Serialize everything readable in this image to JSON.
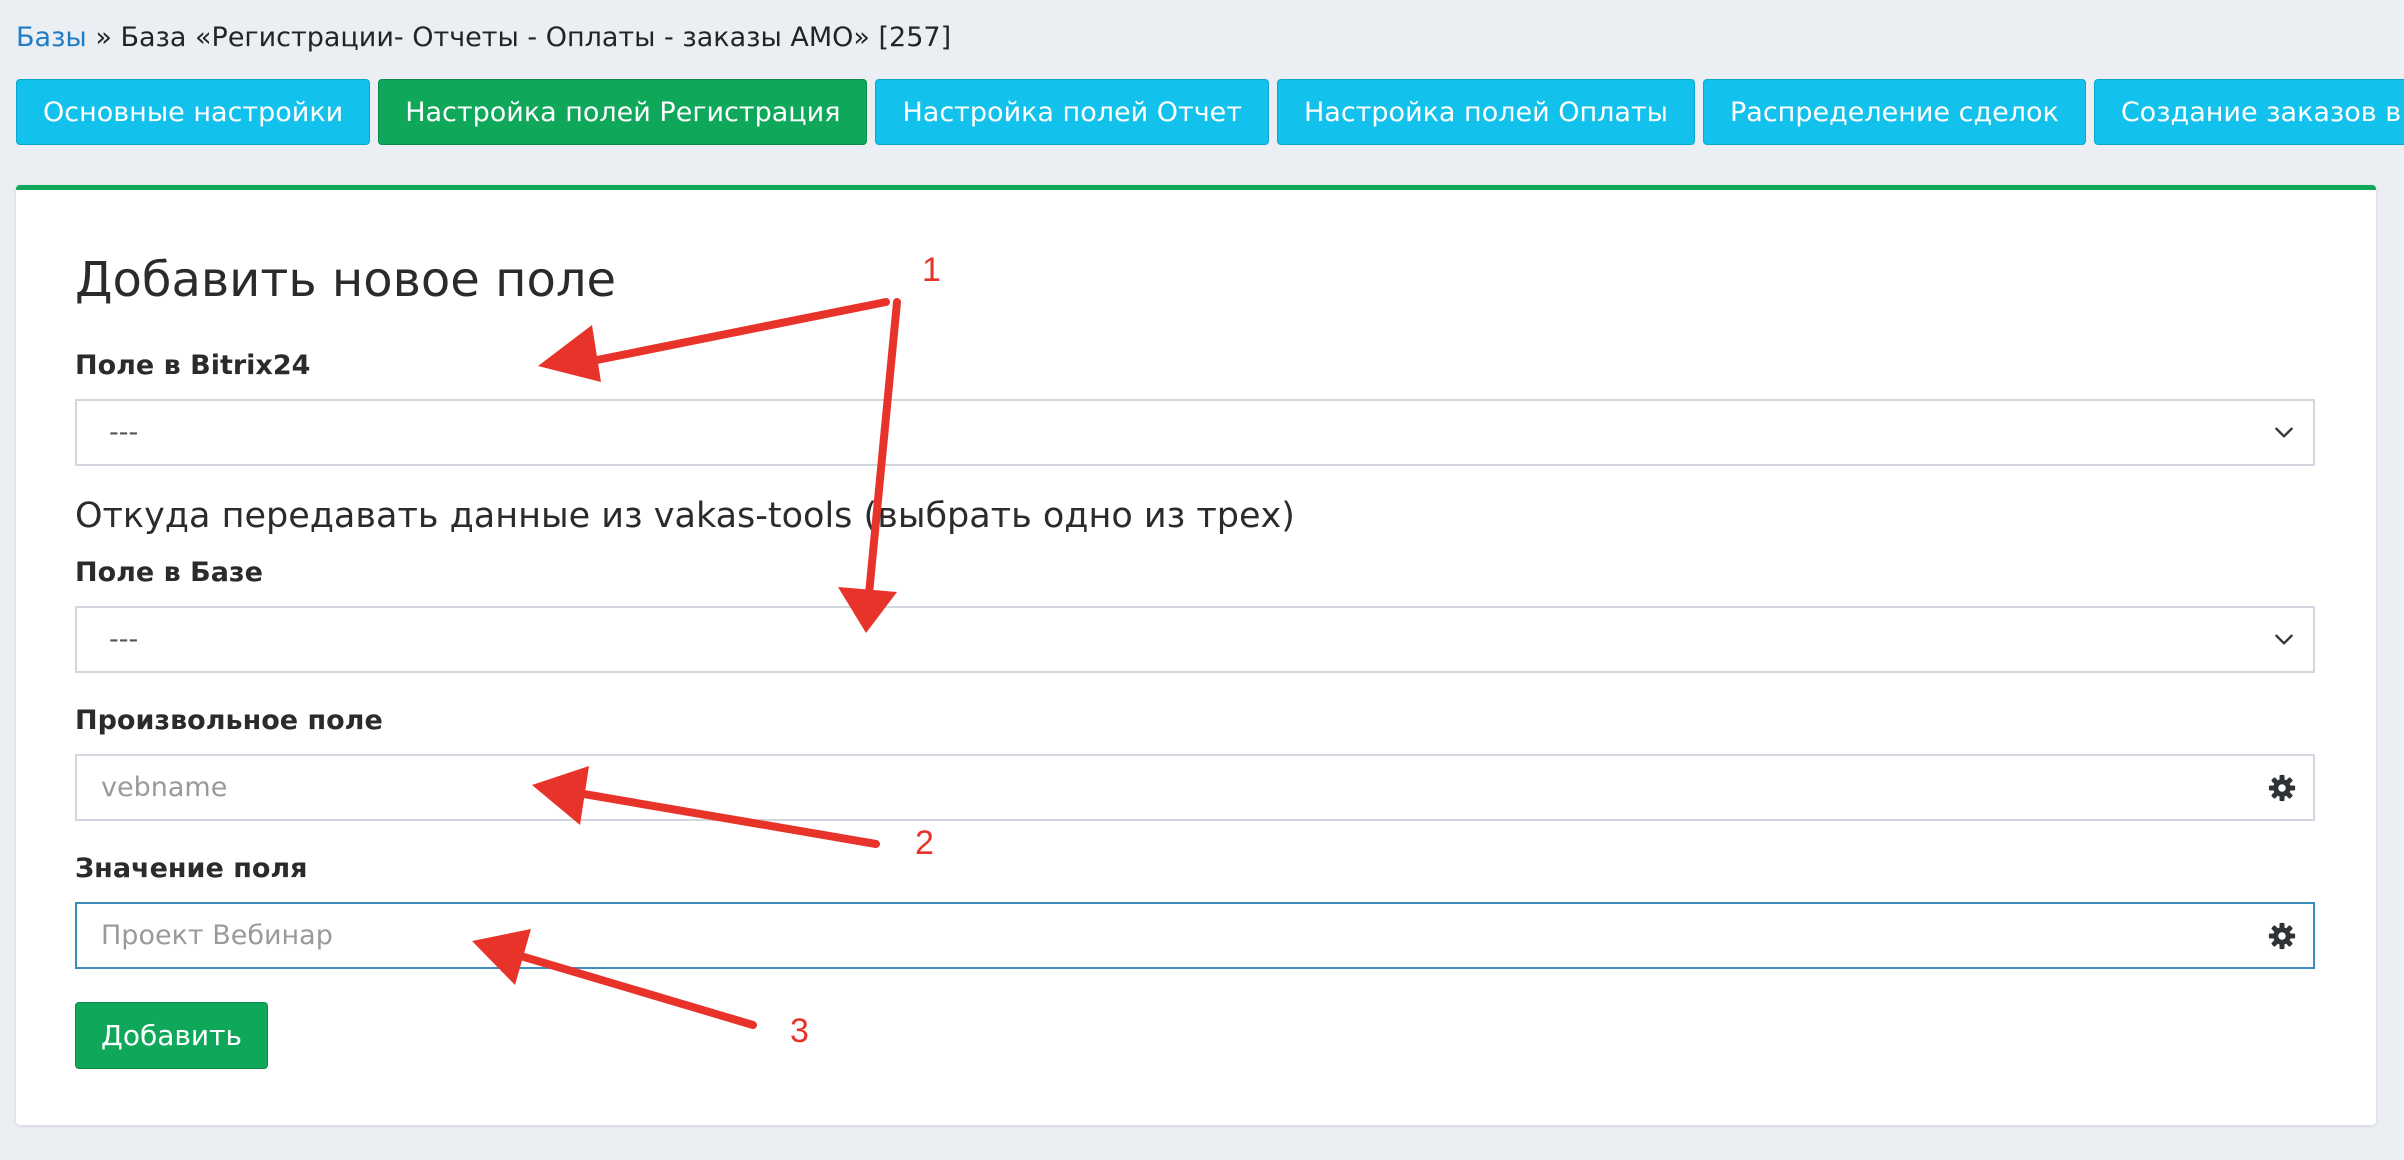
{
  "breadcrumb": {
    "root_link": "Базы",
    "separator": "»",
    "current": "База «Регистрации- Отчеты - Оплаты - заказы АМО» [257]"
  },
  "tabs": [
    {
      "label": "Основные настройки",
      "active": false
    },
    {
      "label": "Настройка полей Регистрация",
      "active": true
    },
    {
      "label": "Настройка полей Отчет",
      "active": false
    },
    {
      "label": "Настройка полей Оплаты",
      "active": false
    },
    {
      "label": "Распределение сделок",
      "active": false
    },
    {
      "label": "Создание заказов в GC",
      "active": false
    }
  ],
  "form": {
    "title": "Добавить новое поле",
    "bitrix_field": {
      "label": "Поле в Bitrix24",
      "selected": "---"
    },
    "source_heading": "Откуда передавать данные из vakas-tools (выбрать одно из трех)",
    "base_field": {
      "label": "Поле в Базе",
      "selected": "---"
    },
    "custom_field": {
      "label": "Произвольное поле",
      "placeholder": "vebname",
      "value": "",
      "icon": "gear-icon"
    },
    "field_value": {
      "label": "Значение поля",
      "placeholder": "Проект Вебинар",
      "value": "",
      "icon": "gear-icon"
    },
    "submit_label": "Добавить"
  },
  "annotations": {
    "marker_1": "1",
    "marker_2": "2",
    "marker_3": "3",
    "color": "#e8332a"
  },
  "colors": {
    "tab_default": "#12c2ec",
    "tab_active": "#0fa85a",
    "button_primary": "#0fa85a",
    "link": "#1f7cc7",
    "page_background": "#ebeef3"
  }
}
